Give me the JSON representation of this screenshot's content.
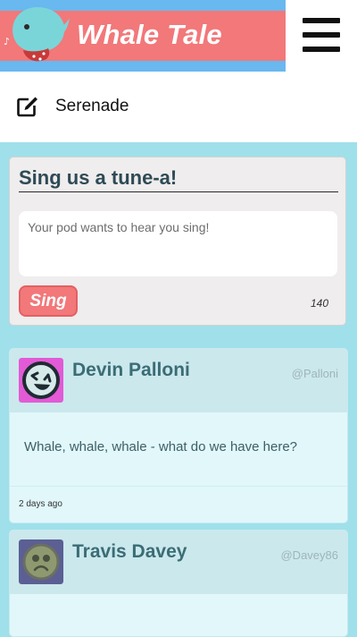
{
  "header": {
    "logo_icon": "whale-logo-icon",
    "title": "Whale Tale",
    "menu_icon": "hamburger-menu-icon",
    "colors": {
      "banner": "#f2787a",
      "stripe": "#69b8ef"
    }
  },
  "nav": {
    "items": [
      {
        "icon": "edit-icon",
        "label": "Serenade"
      }
    ]
  },
  "compose": {
    "title": "Sing us a tune-a!",
    "placeholder": "Your pod wants to hear you sing!",
    "value": "",
    "submit_label": "Sing",
    "char_count": "140"
  },
  "feed": [
    {
      "name": "Devin Palloni",
      "handle": "@Palloni",
      "avatar_icon": "laughing-face-avatar-icon",
      "text": "Whale, whale, whale - what do we have here?",
      "time": "2 days ago"
    },
    {
      "name": "Travis Davey",
      "handle": "@Davey86",
      "avatar_icon": "sad-face-avatar-icon"
    }
  ],
  "colors": {
    "page_bg": "#9fe0ea",
    "accent": "#f2787a",
    "name_text": "#3b6d75"
  }
}
